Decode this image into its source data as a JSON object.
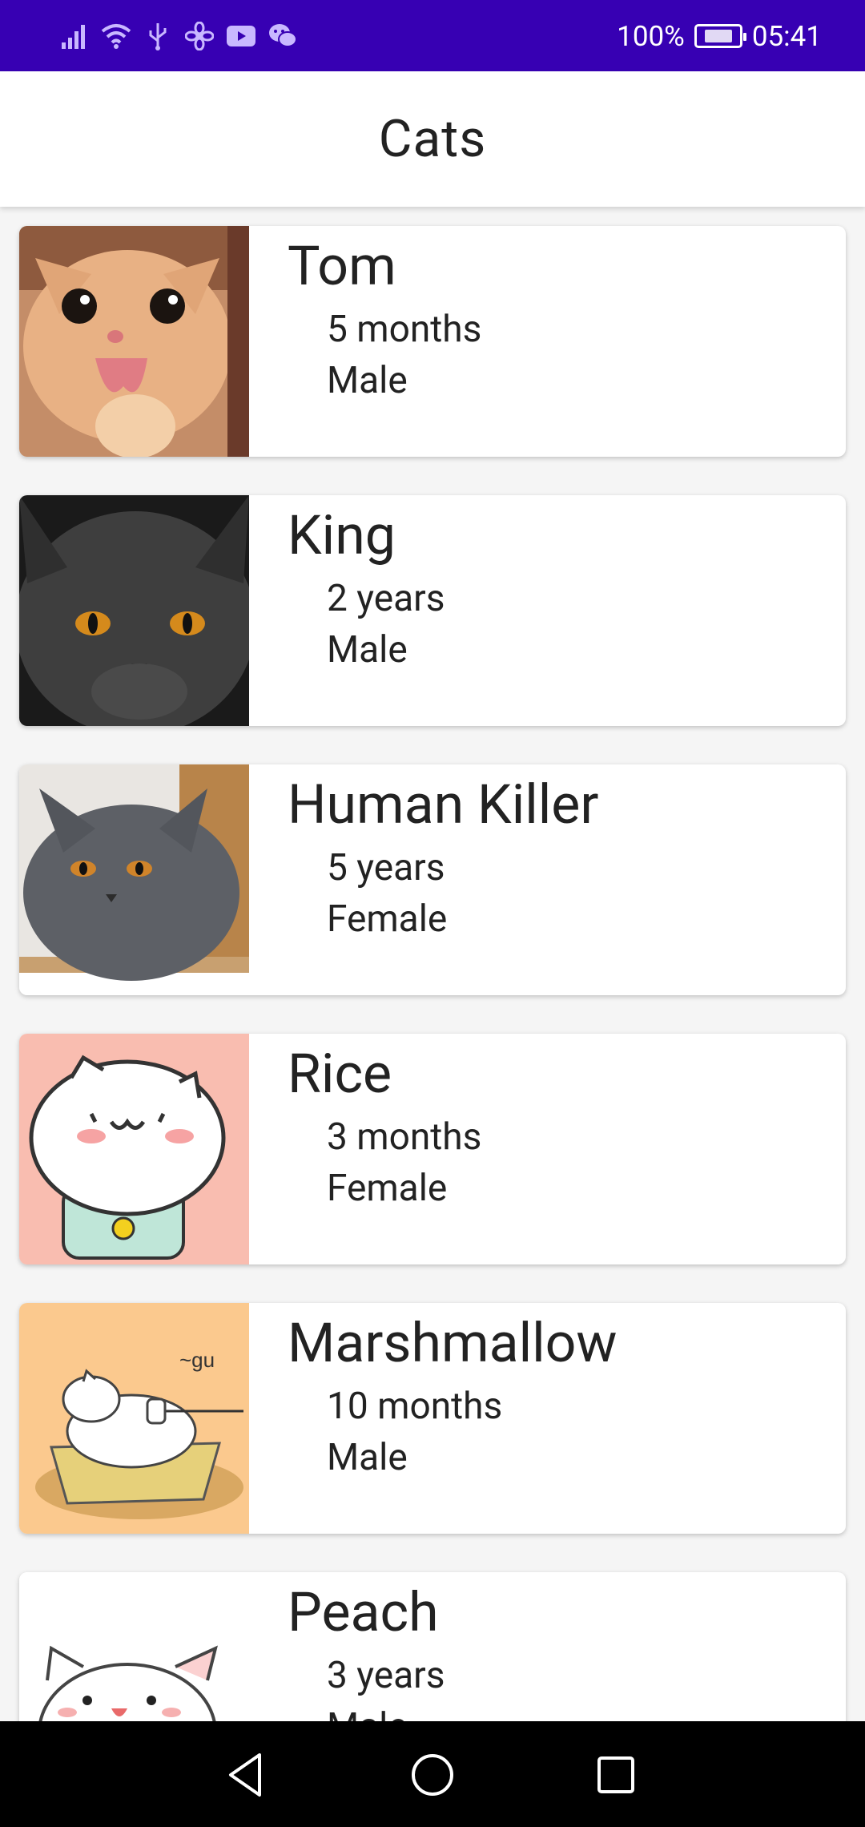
{
  "status_bar": {
    "battery_percent": "100%",
    "time": "05:41",
    "icons": [
      "signal-icon",
      "wifi-icon",
      "usb-icon",
      "fan-icon",
      "youtube-icon",
      "wechat-icon",
      "battery-icon"
    ]
  },
  "app_bar": {
    "title": "Cats"
  },
  "cats": [
    {
      "name": "Tom",
      "age": "5 months",
      "gender": "Male"
    },
    {
      "name": "King",
      "age": "2 years",
      "gender": "Male"
    },
    {
      "name": "Human Killer",
      "age": "5 years",
      "gender": "Female"
    },
    {
      "name": "Rice",
      "age": "3 months",
      "gender": "Female"
    },
    {
      "name": "Marshmallow",
      "age": "10 months",
      "gender": "Male"
    },
    {
      "name": "Peach",
      "age": "3 years",
      "gender": "Male"
    }
  ],
  "nav_bar": {
    "icons": [
      "back-icon",
      "home-icon",
      "recents-icon"
    ]
  },
  "colors": {
    "status_bar": "#3700b3",
    "app_bar": "#ffffff",
    "background": "#f5f5f5",
    "nav_bar": "#000000"
  }
}
